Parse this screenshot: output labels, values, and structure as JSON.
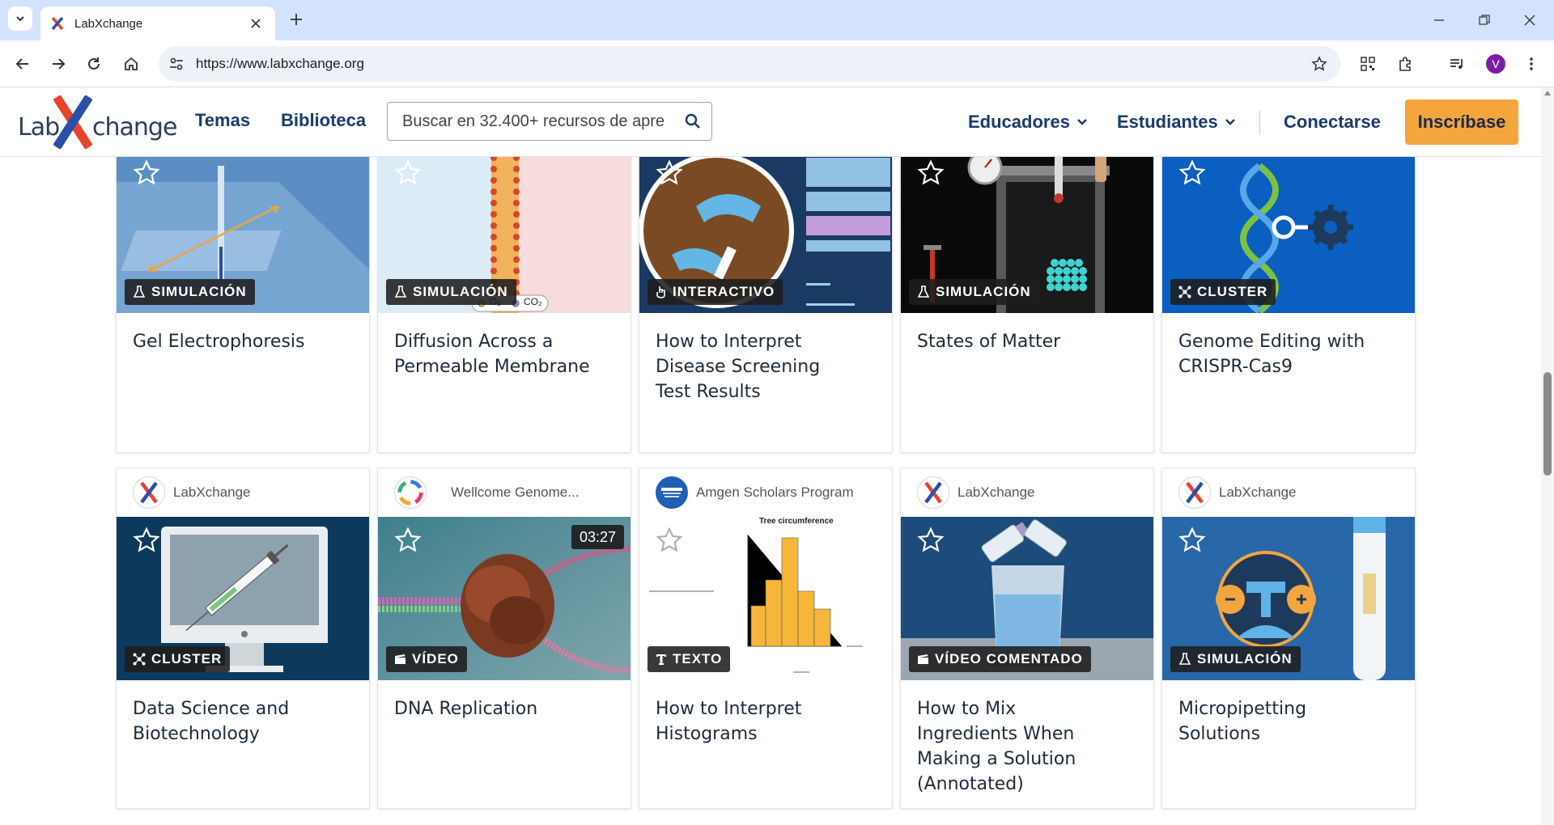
{
  "browser": {
    "tab_title": "LabXchange",
    "url": "https://www.labxchange.org",
    "profile_initial": "V"
  },
  "header": {
    "logo_left": "Lab",
    "logo_x": "X",
    "logo_right": "change",
    "nav_topics": "Temas",
    "nav_library": "Biblioteca",
    "search_placeholder": "Buscar en 32.400+ recursos de apre",
    "educators": "Educadores",
    "students": "Estudiantes",
    "login": "Conectarse",
    "signup": "Inscríbase"
  },
  "cards_row1": [
    {
      "type": "SIMULACIÓN",
      "title_lines": [
        "Gel Electrophoresis"
      ]
    },
    {
      "type": "SIMULACIÓN",
      "title_lines": [
        "Diffusion Across a",
        "Permeable Membrane"
      ],
      "thumb_labels": [
        "O₂",
        "CO₂"
      ]
    },
    {
      "type": "INTERACTIVO",
      "title_lines": [
        "How to Interpret",
        "Disease Screening",
        "Test Results"
      ]
    },
    {
      "type": "SIMULACIÓN",
      "title_lines": [
        "States of Matter"
      ]
    },
    {
      "type": "CLUSTER",
      "title_lines": [
        "Genome Editing with",
        "CRISPR-Cas9"
      ]
    }
  ],
  "cards_row2": [
    {
      "source": "LabXchange",
      "type": "CLUSTER",
      "title_lines": [
        "Data Science and",
        "Biotechnology"
      ]
    },
    {
      "source": "Wellcome Genome...",
      "type": "VÍDEO",
      "duration": "03:27",
      "title_lines": [
        "DNA Replication"
      ]
    },
    {
      "source": "Amgen Scholars Program",
      "type": "TEXTO",
      "title_lines": [
        "How to Interpret",
        "Histograms"
      ],
      "chart_title": "Tree circumference"
    },
    {
      "source": "LabXchange",
      "type": "VÍDEO COMENTADO",
      "title_lines": [
        "How to Mix",
        "Ingredients When",
        "Making a Solution",
        "(Annotated)"
      ]
    },
    {
      "source": "LabXchange",
      "type": "SIMULACIÓN",
      "title_lines": [
        "Micropipetting",
        "Solutions"
      ]
    }
  ],
  "colors": {
    "brand_navy": "#1b3a6b",
    "signup_orange": "#f5a53d",
    "logo_red": "#e8432e",
    "logo_blue": "#2a4fa8"
  }
}
